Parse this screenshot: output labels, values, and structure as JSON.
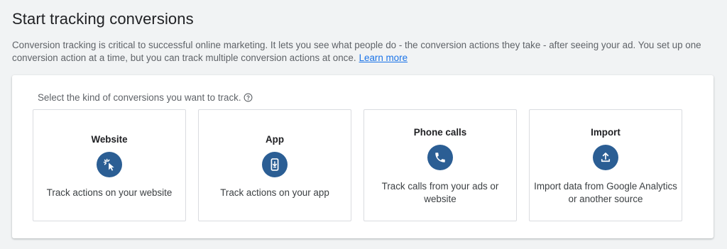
{
  "header": {
    "title": "Start tracking conversions"
  },
  "intro": {
    "text": "Conversion tracking is critical to successful online marketing. It lets you see what people do - the conversion actions they take - after seeing your ad. You set up one conversion action at a time, but you can track multiple conversion actions at once.",
    "link_label": "Learn more"
  },
  "selector": {
    "prompt": "Select the kind of conversions you want to track.",
    "help_icon": "help-circle-icon",
    "options": [
      {
        "title": "Website",
        "icon": "cursor-click-icon",
        "description": "Track actions on your website"
      },
      {
        "title": "App",
        "icon": "mobile-download-icon",
        "description": "Track actions on your app"
      },
      {
        "title": "Phone calls",
        "icon": "phone-icon",
        "description": "Track calls from your ads or website"
      },
      {
        "title": "Import",
        "icon": "upload-icon",
        "description": "Import data from Google Analytics or another source"
      }
    ]
  },
  "colors": {
    "icon_circle": "#2b5e94",
    "link": "#1a73e8",
    "background": "#f1f3f4"
  }
}
